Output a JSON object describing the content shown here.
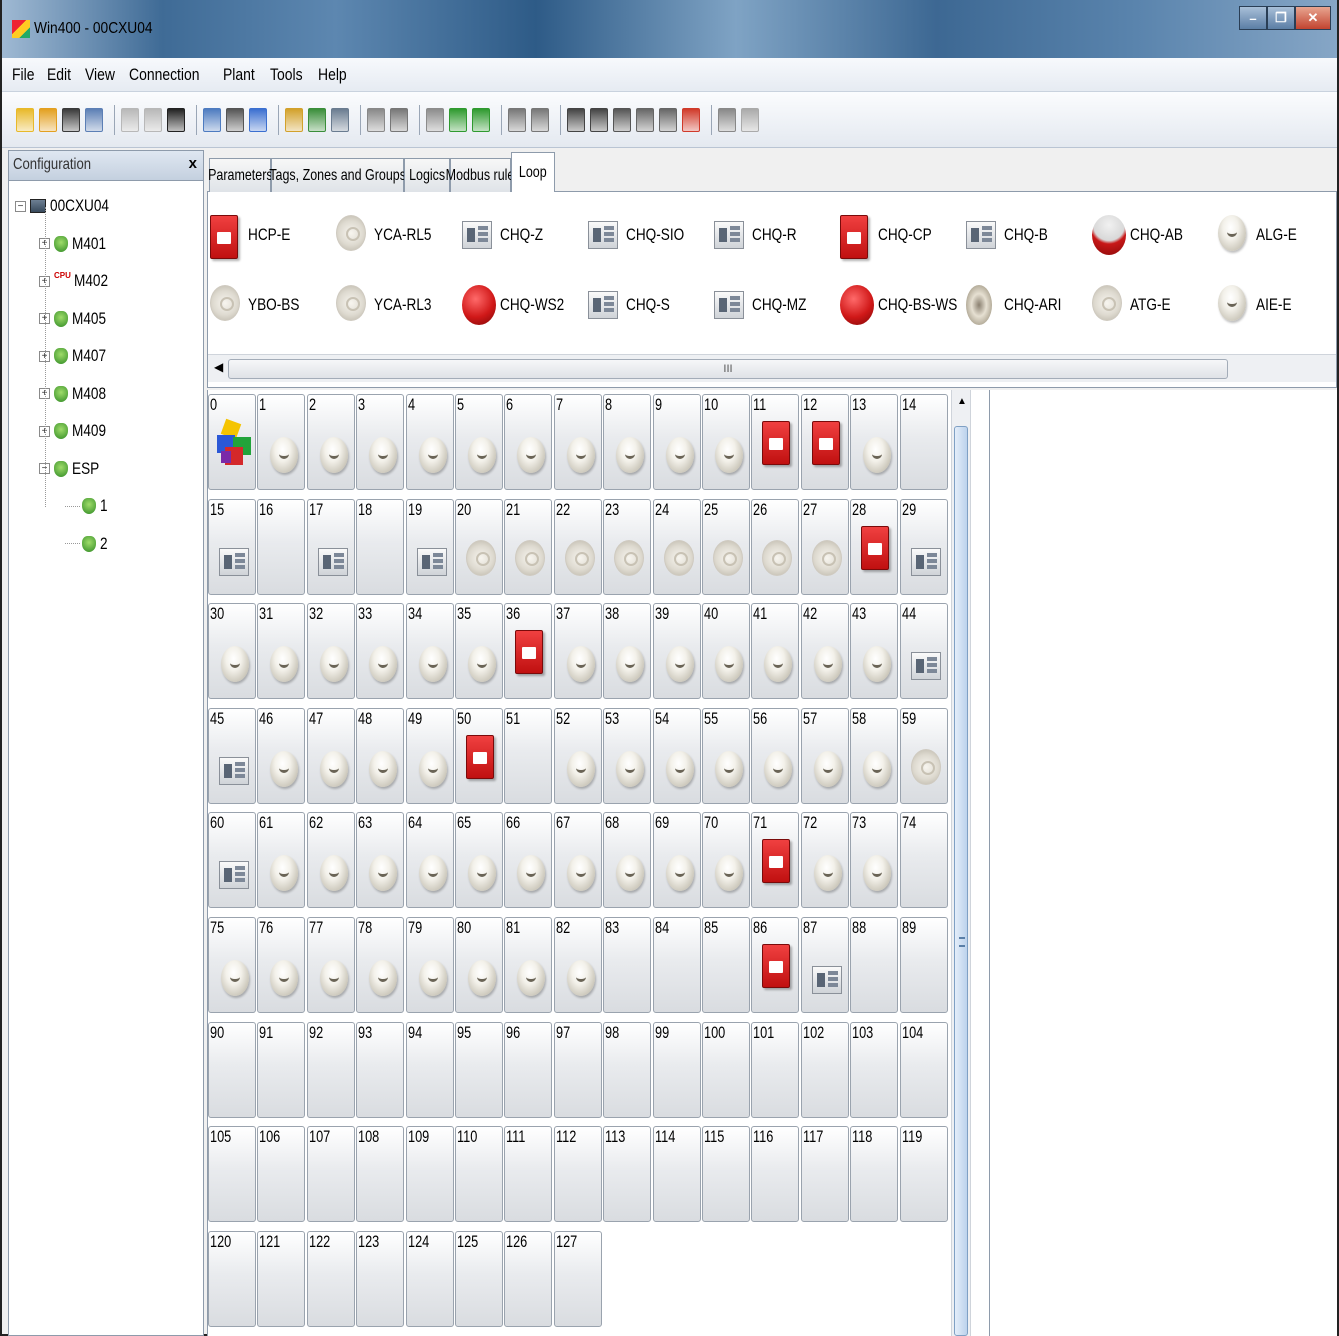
{
  "window": {
    "title": "Win400 - 00CXU04",
    "controls": [
      "–",
      "❐",
      "✕"
    ]
  },
  "menu": [
    "File",
    "Edit",
    "View",
    "Connection",
    "Plant",
    "Tools",
    "Help"
  ],
  "toolbar": {
    "icons": [
      {
        "name": "new-icon",
        "color": "#e8b92a"
      },
      {
        "name": "open-icon",
        "color": "#e3a020"
      },
      {
        "name": "save-icon",
        "color": "#3a3a3a"
      },
      {
        "name": "print-icon",
        "color": "#5c7fb5"
      },
      {
        "sep": true
      },
      {
        "name": "copy-icon",
        "color": "#b8b8b8"
      },
      {
        "name": "paste-icon",
        "color": "#b8b8b8"
      },
      {
        "name": "delete-icon",
        "color": "#222222"
      },
      {
        "sep": true
      },
      {
        "name": "window-icon",
        "color": "#4d7bc0"
      },
      {
        "name": "find-icon",
        "color": "#555555"
      },
      {
        "name": "info-icon",
        "color": "#3b6fd0"
      },
      {
        "sep": true
      },
      {
        "name": "connect-icon",
        "color": "#d2a12b"
      },
      {
        "name": "download-icon",
        "color": "#3a8e3a"
      },
      {
        "name": "upload-icon",
        "color": "#6a7c90"
      },
      {
        "sep": true
      },
      {
        "name": "compare-icon",
        "color": "#888888"
      },
      {
        "name": "sync-icon",
        "color": "#777777"
      },
      {
        "sep": true
      },
      {
        "name": "tools-icon",
        "color": "#8c8c8c"
      },
      {
        "name": "green-icon",
        "color": "#2f9a2f"
      },
      {
        "name": "green2-icon",
        "color": "#2f9a2f"
      },
      {
        "sep": true
      },
      {
        "name": "plug-icon",
        "color": "#777777"
      },
      {
        "name": "plug2-icon",
        "color": "#777777"
      },
      {
        "sep": true
      },
      {
        "name": "t-icon",
        "color": "#444444"
      },
      {
        "name": "z-icon",
        "color": "#444444"
      },
      {
        "name": "g-icon",
        "color": "#555555"
      },
      {
        "name": "b1-icon",
        "color": "#666666"
      },
      {
        "name": "b2-icon",
        "color": "#666666"
      },
      {
        "name": "flag-icon",
        "color": "#d03a2a"
      },
      {
        "sep": true
      },
      {
        "name": "lock-icon",
        "color": "#888888"
      },
      {
        "name": "help-icon",
        "color": "#aaaaaa"
      }
    ]
  },
  "left_panel": {
    "title": "Configuration",
    "close": "x",
    "tree": [
      {
        "label": "00CXU04",
        "level": 0,
        "icon": "pc",
        "exp": "−"
      },
      {
        "label": "M401",
        "level": 1,
        "icon": "leaf",
        "exp": "+"
      },
      {
        "label": "M402",
        "level": 1,
        "icon": "cpu",
        "exp": "+"
      },
      {
        "label": "M405",
        "level": 1,
        "icon": "leaf",
        "exp": "+"
      },
      {
        "label": "M407",
        "level": 1,
        "icon": "leaf",
        "exp": "+"
      },
      {
        "label": "M408",
        "level": 1,
        "icon": "leaf",
        "exp": "+"
      },
      {
        "label": "M409",
        "level": 1,
        "icon": "leaf",
        "exp": "+"
      },
      {
        "label": "ESP",
        "level": 1,
        "icon": "leaf",
        "exp": "−"
      },
      {
        "label": "1",
        "level": 2,
        "icon": "leaf",
        "exp": ""
      },
      {
        "label": "2",
        "level": 2,
        "icon": "leaf",
        "exp": ""
      }
    ],
    "cpu_badge": "CPU"
  },
  "tabs": [
    {
      "label": "Parameters",
      "active": false
    },
    {
      "label": "Tags, Zones and Groups",
      "active": false
    },
    {
      "label": "Logics",
      "active": false
    },
    {
      "label": "Modbus rule",
      "active": false
    },
    {
      "label": "Loop",
      "active": true
    }
  ],
  "palette": [
    {
      "label": "HCP-E",
      "icon": "callpoint"
    },
    {
      "label": "YCA-RL5",
      "icon": "base"
    },
    {
      "label": "CHQ-Z",
      "icon": "module"
    },
    {
      "label": "CHQ-SIO",
      "icon": "module"
    },
    {
      "label": "CHQ-R",
      "icon": "module"
    },
    {
      "label": "CHQ-CP",
      "icon": "callpoint"
    },
    {
      "label": "CHQ-B",
      "icon": "module"
    },
    {
      "label": "CHQ-AB",
      "icon": "ab"
    },
    {
      "label": "ALG-E",
      "icon": "detector"
    },
    {
      "label": "YBO-BS",
      "icon": "base"
    },
    {
      "label": "YCA-RL3",
      "icon": "base"
    },
    {
      "label": "CHQ-WS2",
      "icon": "sounder"
    },
    {
      "label": "CHQ-S",
      "icon": "module"
    },
    {
      "label": "CHQ-MZ",
      "icon": "module"
    },
    {
      "label": "CHQ-BS-WS",
      "icon": "sounder"
    },
    {
      "label": "CHQ-ARI",
      "icon": "ari"
    },
    {
      "label": "ATG-E",
      "icon": "base"
    },
    {
      "label": "AIE-E",
      "icon": "detector"
    }
  ],
  "palette_scroll_grip": "III",
  "loop_cells": [
    "root",
    "detector",
    "detector",
    "detector",
    "detector",
    "detector",
    "detector",
    "detector",
    "detector",
    "detector",
    "detector",
    "callpoint",
    "callpoint",
    "detector",
    "",
    "module",
    "",
    "module",
    "",
    "module",
    "base",
    "base",
    "base",
    "base",
    "base",
    "base",
    "base",
    "base",
    "callpoint",
    "module",
    "detector",
    "detector",
    "detector",
    "detector",
    "detector",
    "detector",
    "callpoint",
    "detector",
    "detector",
    "detector",
    "detector",
    "detector",
    "detector",
    "detector",
    "module",
    "module",
    "detector",
    "detector",
    "detector",
    "detector",
    "callpoint",
    "",
    "detector",
    "detector",
    "detector",
    "detector",
    "detector",
    "detector",
    "detector",
    "base",
    "module",
    "detector",
    "detector",
    "detector",
    "detector",
    "detector",
    "detector",
    "detector",
    "detector",
    "detector",
    "detector",
    "callpoint",
    "detector",
    "detector",
    "",
    "detector",
    "detector",
    "detector",
    "detector",
    "detector",
    "detector",
    "detector",
    "detector",
    "",
    "",
    "",
    "callpoint",
    "module",
    "",
    "",
    "",
    "",
    "",
    "",
    "",
    "",
    "",
    "",
    "",
    "",
    "",
    "",
    "",
    "",
    "",
    "",
    "",
    "",
    "",
    "",
    "",
    "",
    "",
    "",
    "",
    "",
    "",
    "",
    "",
    "",
    "",
    "",
    "",
    "",
    "",
    "",
    "",
    ""
  ],
  "loop_numbers": [
    "0",
    "1",
    "2",
    "3",
    "4",
    "5",
    "6",
    "7",
    "8",
    "9",
    "10",
    "11",
    "12",
    "13",
    "14",
    "15",
    "16",
    "17",
    "18",
    "19",
    "20",
    "21",
    "22",
    "23",
    "24",
    "25",
    "26",
    "27",
    "28",
    "29",
    "30",
    "31",
    "32",
    "33",
    "34",
    "35",
    "36",
    "37",
    "38",
    "39",
    "40",
    "41",
    "42",
    "43",
    "44",
    "45",
    "46",
    "47",
    "48",
    "49",
    "50",
    "51",
    "52",
    "53",
    "54",
    "55",
    "56",
    "57",
    "58",
    "59",
    "60",
    "61",
    "62",
    "63",
    "64",
    "65",
    "66",
    "67",
    "68",
    "69",
    "70",
    "71",
    "72",
    "73",
    "74",
    "75",
    "76",
    "77",
    "78",
    "79",
    "80",
    "81",
    "82",
    "83",
    "84",
    "85",
    "86",
    "87",
    "88",
    "89",
    "90",
    "91",
    "92",
    "93",
    "94",
    "95",
    "96",
    "97",
    "98",
    "99",
    "100",
    "101",
    "102",
    "103",
    "104",
    "105",
    "106",
    "107",
    "108",
    "109",
    "110",
    "111",
    "112",
    "113",
    "114",
    "115",
    "116",
    "117",
    "118",
    "119",
    "120",
    "121",
    "122",
    "123",
    "124",
    "125",
    "126",
    "127"
  ]
}
